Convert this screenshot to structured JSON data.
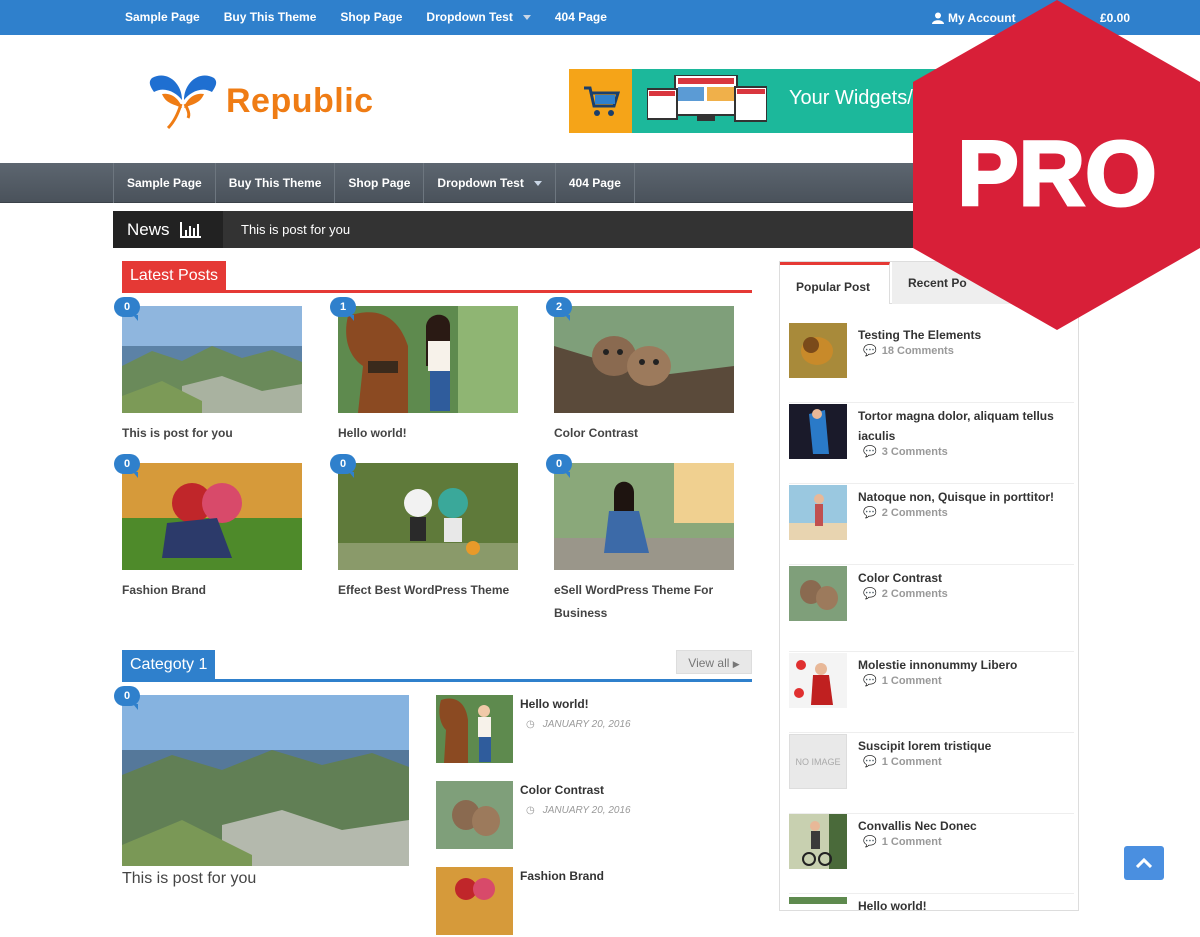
{
  "topbar": {
    "nav": [
      "Sample Page",
      "Buy This Theme",
      "Shop Page",
      "Dropdown Test",
      "404 Page"
    ],
    "account": "My Account",
    "cart_total": "£0.00",
    "colors": {
      "background": "#2f80cc"
    }
  },
  "logo": {
    "text": "Republic"
  },
  "banner": {
    "text": "Your Widgets/"
  },
  "mainnav": {
    "items": [
      "Sample Page",
      "Buy This Theme",
      "Shop Page",
      "Dropdown Test",
      "404 Page"
    ]
  },
  "news": {
    "label": "News",
    "ticker": "This is post for you"
  },
  "latest": {
    "heading": "Latest Posts",
    "color": "#e53935",
    "posts": [
      {
        "count": "0",
        "title": "This is post for you",
        "image": "mountain-lake"
      },
      {
        "count": "1",
        "title": "Hello world!",
        "image": "girl-with-horse"
      },
      {
        "count": "2",
        "title": "Color Contrast",
        "image": "kittens-on-tree"
      },
      {
        "count": "0",
        "title": "Fashion Brand",
        "image": "anime-couple"
      },
      {
        "count": "0",
        "title": "Effect Best WordPress Theme",
        "image": "figurines"
      },
      {
        "count": "0",
        "title": "eSell WordPress Theme For Business",
        "image": "girl-on-steps"
      }
    ]
  },
  "category": {
    "heading": "Categoty 1",
    "view_all": "View all",
    "color": "#2f80cc",
    "featured": {
      "count": "0",
      "title": "This is post for you"
    },
    "list": [
      {
        "title": "Hello world!",
        "date": "JANUARY 20, 2016"
      },
      {
        "title": "Color Contrast",
        "date": "JANUARY 20, 2016"
      },
      {
        "title": "Fashion Brand",
        "date": ""
      }
    ]
  },
  "sidebar": {
    "tabs": [
      "Popular Post",
      "Recent Po"
    ],
    "items": [
      {
        "title": "Testing The Elements",
        "comments": "18 Comments"
      },
      {
        "title": "Tortor magna dolor, aliquam tellus iaculis",
        "comments": "3 Comments"
      },
      {
        "title": "Natoque non, Quisque in porttitor!",
        "comments": "2 Comments"
      },
      {
        "title": "Color Contrast",
        "comments": "2 Comments"
      },
      {
        "title": "Molestie innonummy Libero",
        "comments": "1 Comment"
      },
      {
        "title": "Suscipit lorem tristique",
        "comments": "1 Comment",
        "no_image": "NO IMAGE"
      },
      {
        "title": "Convallis Nec Donec",
        "comments": "1 Comment"
      },
      {
        "title": "Hello world!",
        "comments": ""
      }
    ]
  },
  "badge": {
    "text": "PRO",
    "color": "#d81f38"
  }
}
